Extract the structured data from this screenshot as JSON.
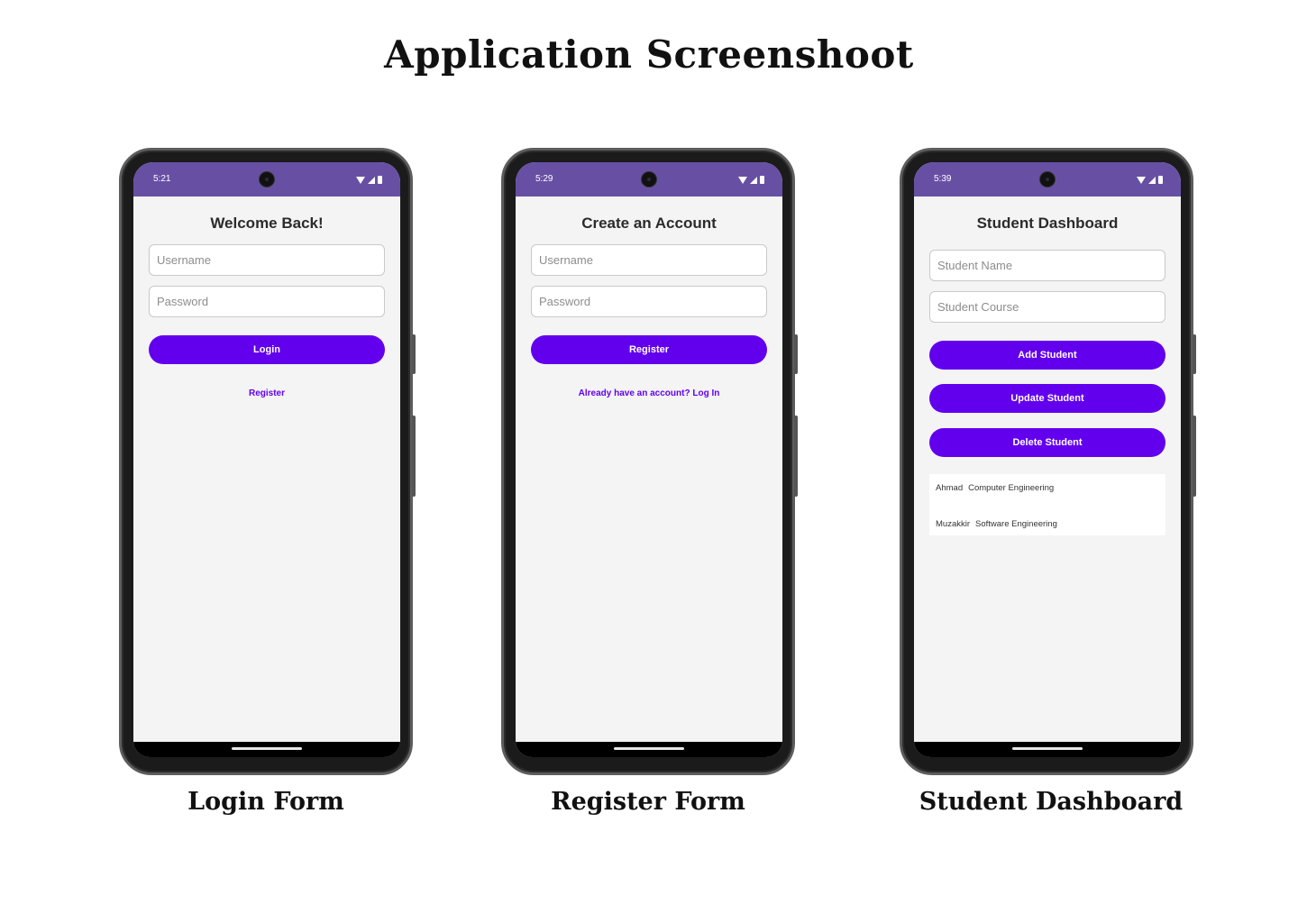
{
  "page_title": "Application Screenshoot",
  "colors": {
    "status_bar": "#6750a4",
    "primary": "#6200ee",
    "screen_bg": "#f4f4f4"
  },
  "phones": [
    {
      "caption": "Login Form",
      "status_time": "5:21",
      "title": "Welcome Back!",
      "username_placeholder": "Username",
      "password_placeholder": "Password",
      "primary_button": "Login",
      "link": "Register"
    },
    {
      "caption": "Register Form",
      "status_time": "5:29",
      "title": "Create an Account",
      "username_placeholder": "Username",
      "password_placeholder": "Password",
      "primary_button": "Register",
      "link": "Already have an account? Log In"
    },
    {
      "caption": "Student Dashboard",
      "status_time": "5:39",
      "title": "Student Dashboard",
      "name_placeholder": "Student Name",
      "course_placeholder": "Student Course",
      "add_button": "Add Student",
      "update_button": "Update Student",
      "delete_button": "Delete Student",
      "students": [
        {
          "name": "Ahmad",
          "course": "Computer Engineering"
        },
        {
          "name": "Muzakkir",
          "course": "Software Engineering"
        }
      ]
    }
  ],
  "icons": [
    "wifi-icon",
    "signal-icon",
    "battery-icon",
    "front-camera"
  ]
}
